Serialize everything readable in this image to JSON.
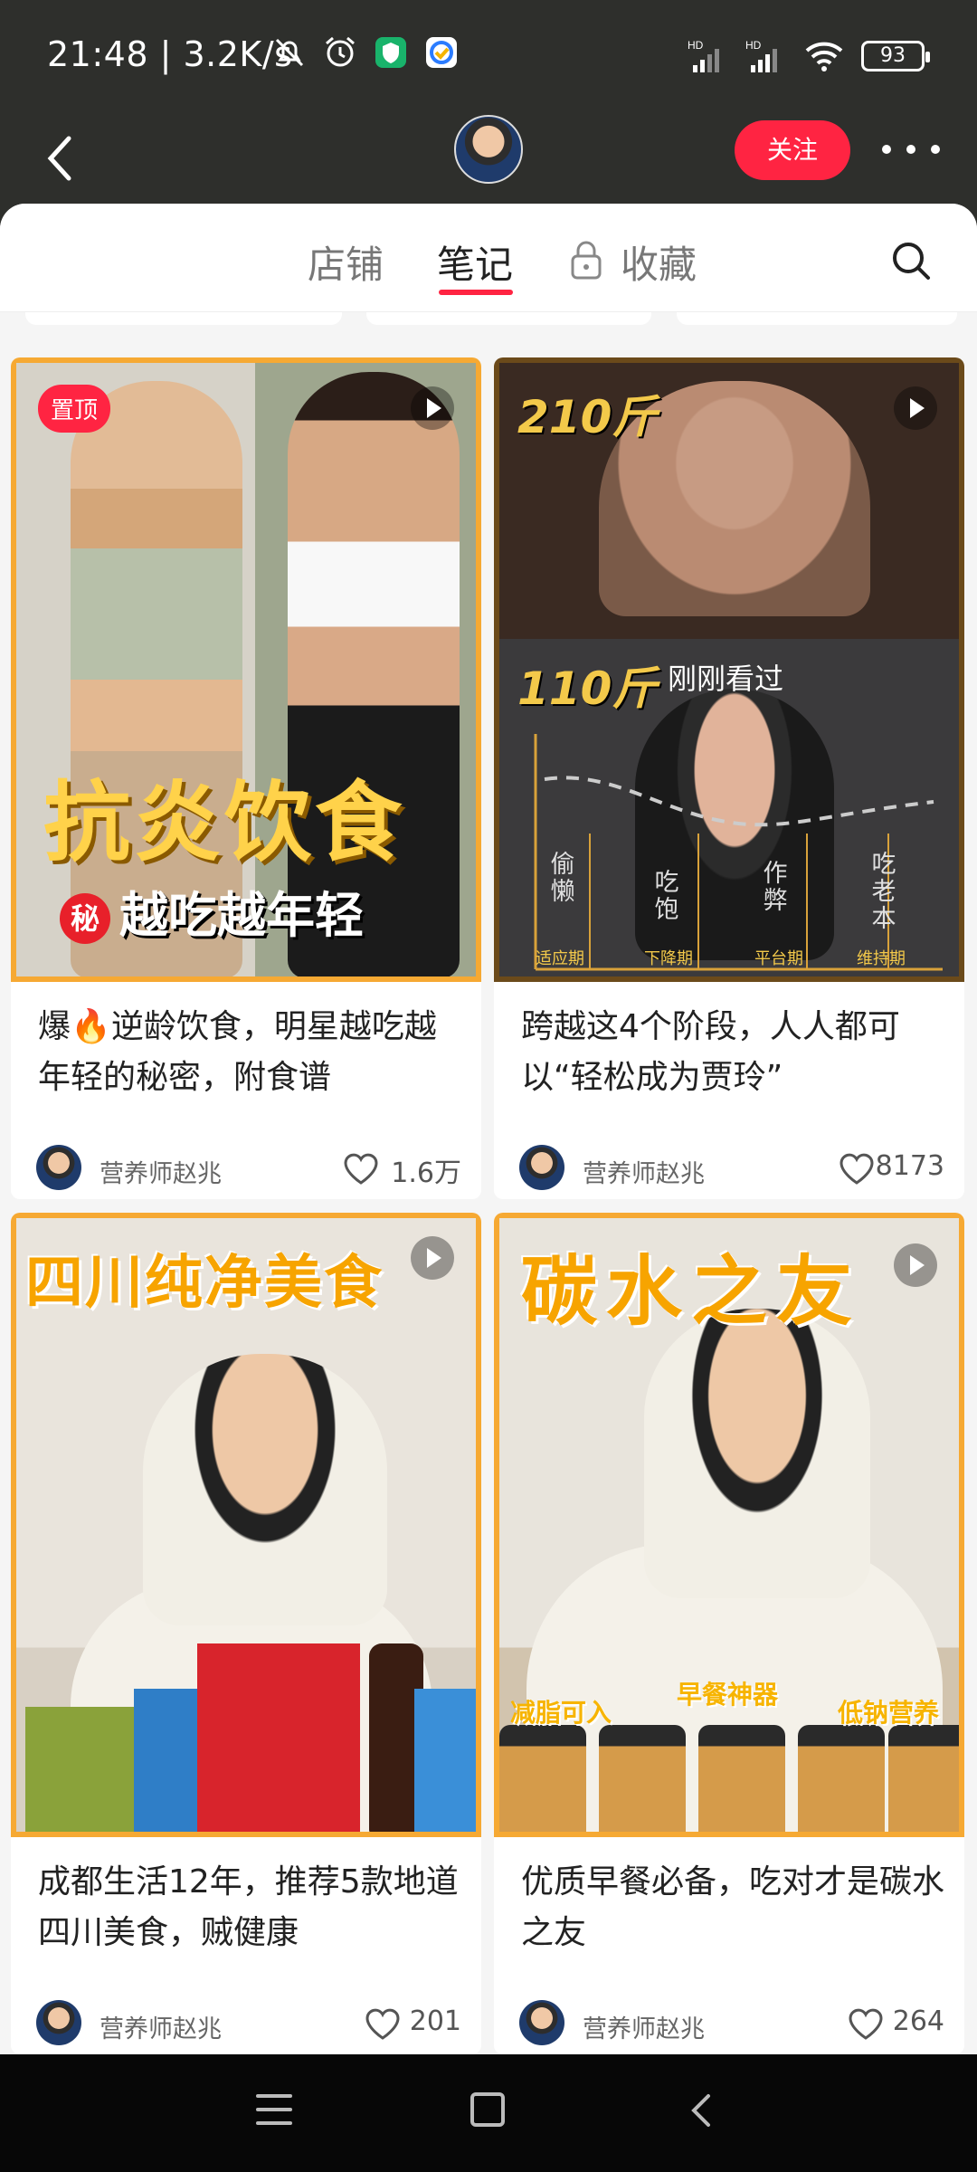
{
  "status_bar": {
    "time": "21:48",
    "speed": "3.2K/s",
    "battery": "93"
  },
  "header": {
    "follow_label": "关注"
  },
  "tabs": [
    {
      "label": "店铺",
      "active": false
    },
    {
      "label": "笔记",
      "active": true
    },
    {
      "label": "收藏",
      "active": false
    }
  ],
  "notes": [
    {
      "title": "爆🔥逆龄饮食，明星越吃越年轻的秘密，附食谱",
      "author": "营养师赵兆",
      "likes": "1.6万",
      "pinned_label": "置顶",
      "caption_main": "抗炎饮食",
      "caption_badge": "秘",
      "caption_sub": "越吃越年轻"
    },
    {
      "title": "跨越这4个阶段，人人都可以“轻松成为贾玲”",
      "author": "营养师赵兆",
      "likes": "8173",
      "label_top": "210斤",
      "label_mid": "110斤",
      "seen_label": "刚刚看过",
      "phases": [
        "偷懒",
        "吃饱",
        "作弊",
        "吃老本"
      ],
      "phase_axis": [
        "适应期",
        "下降期",
        "平台期",
        "维持期"
      ]
    },
    {
      "title": "成都生活12年，推荐5款地道四川美食，贼健康",
      "author": "营养师赵兆",
      "likes": "201",
      "caption_top": "四川纯净美食"
    },
    {
      "title": "优质早餐必备，吃对才是碳水之友",
      "author": "营养师赵兆",
      "likes": "264",
      "caption_top": "碳水之友",
      "jar_labels": [
        "减脂可入",
        "早餐神器",
        "低钠营养"
      ]
    }
  ]
}
